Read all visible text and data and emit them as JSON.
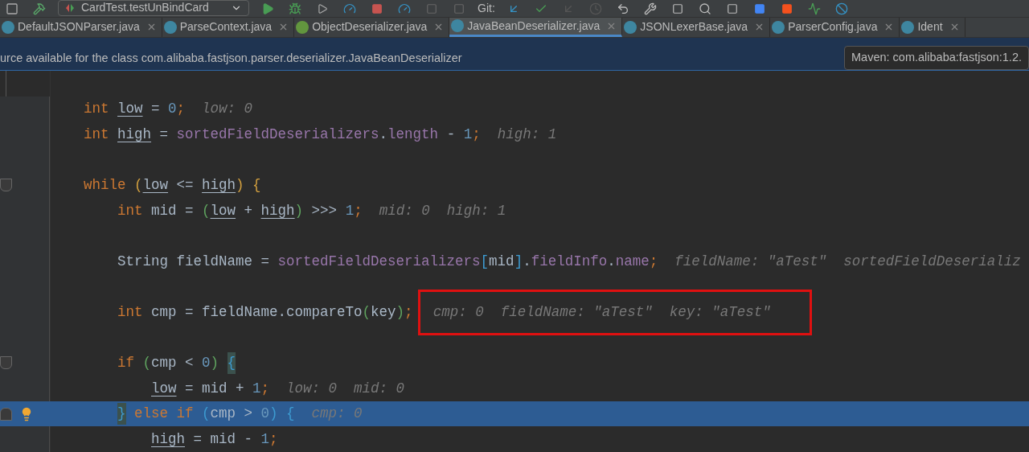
{
  "toolbar": {
    "run_config": "CardTest.testUnBindCard",
    "git_label": "Git:"
  },
  "tabs": [
    {
      "label": "DefaultJSONParser.java",
      "kind": "class",
      "selected": false
    },
    {
      "label": "ParseContext.java",
      "kind": "class",
      "selected": false
    },
    {
      "label": "ObjectDeserializer.java",
      "kind": "interface",
      "selected": false
    },
    {
      "label": "JavaBeanDeserializer.java",
      "kind": "class",
      "selected": true
    },
    {
      "label": "JSONLexerBase.java",
      "kind": "class",
      "selected": false
    },
    {
      "label": "ParserConfig.java",
      "kind": "class",
      "selected": false
    },
    {
      "label": "Ident",
      "kind": "class",
      "selected": false
    }
  ],
  "banner": {
    "message": "urce available for the class com.alibaba.fastjson.parser.deserializer.JavaBeanDeserializer",
    "library": "Maven: com.alibaba:fastjson:1.2."
  },
  "code_lines": [
    {
      "current": false,
      "boxed": false,
      "tokens": [
        {
          "text": "int ",
          "kind": "keyword"
        },
        {
          "text": "low",
          "kind": "local"
        },
        {
          "text": " = ",
          "kind": "plain"
        },
        {
          "text": "0",
          "kind": "number"
        },
        {
          "text": ";",
          "kind": "keyword"
        },
        {
          "text": "low: 0",
          "kind": "hint"
        }
      ]
    },
    {
      "current": false,
      "boxed": false,
      "tokens": [
        {
          "text": "int ",
          "kind": "keyword"
        },
        {
          "text": "high",
          "kind": "local"
        },
        {
          "text": " = ",
          "kind": "plain"
        },
        {
          "text": "sortedFieldDeserializers",
          "kind": "field"
        },
        {
          "text": ".",
          "kind": "plain"
        },
        {
          "text": "length",
          "kind": "field"
        },
        {
          "text": " - ",
          "kind": "plain"
        },
        {
          "text": "1",
          "kind": "number"
        },
        {
          "text": ";",
          "kind": "keyword"
        },
        {
          "text": "high: 1",
          "kind": "hint"
        }
      ]
    },
    {
      "current": false,
      "boxed": false
    },
    {
      "current": false,
      "boxed": false,
      "tokens": [
        {
          "text": "while ",
          "kind": "keyword"
        },
        {
          "text": "(",
          "kind": "paren"
        },
        {
          "text": "low",
          "kind": "local"
        },
        {
          "text": " <= ",
          "kind": "plain"
        },
        {
          "text": "high",
          "kind": "local"
        },
        {
          "text": ")",
          "kind": "paren"
        },
        {
          "text": " {",
          "kind": "paren"
        }
      ],
      "children": [
        {
          "current": false,
          "boxed": false,
          "tokens": [
            {
              "text": "int ",
              "kind": "keyword"
            },
            {
              "text": "mid = ",
              "kind": "plain"
            },
            {
              "text": "(",
              "kind": "paren-inner"
            },
            {
              "text": "low",
              "kind": "local"
            },
            {
              "text": " + ",
              "kind": "plain"
            },
            {
              "text": "high",
              "kind": "local"
            },
            {
              "text": ")",
              "kind": "paren-inner"
            },
            {
              "text": " >>> ",
              "kind": "plain"
            },
            {
              "text": "1",
              "kind": "number"
            },
            {
              "text": ";",
              "kind": "keyword"
            },
            {
              "text": "mid: 0  high: 1",
              "kind": "hint"
            }
          ]
        },
        {
          "current": false,
          "boxed": false
        },
        {
          "current": false,
          "boxed": false,
          "tokens": [
            {
              "text": "String fieldName = ",
              "kind": "plain"
            },
            {
              "text": "sortedFieldDeserializers",
              "kind": "field"
            },
            {
              "text": "[",
              "kind": "bracket"
            },
            {
              "text": "mid",
              "kind": "plain"
            },
            {
              "text": "]",
              "kind": "bracket"
            },
            {
              "text": ".",
              "kind": "plain"
            },
            {
              "text": "fieldInfo",
              "kind": "field"
            },
            {
              "text": ".",
              "kind": "plain"
            },
            {
              "text": "name",
              "kind": "field"
            },
            {
              "text": ";",
              "kind": "keyword"
            },
            {
              "text": "fieldName: \"aTest\"  sortedFieldDeserializ",
              "kind": "hint"
            }
          ]
        },
        {
          "current": false,
          "boxed": false
        },
        {
          "current": false,
          "boxed": true,
          "tokens": [
            {
              "text": "int ",
              "kind": "keyword"
            },
            {
              "text": "cmp = fieldName.compareTo",
              "kind": "plain"
            },
            {
              "text": "(",
              "kind": "paren-inner"
            },
            {
              "text": "key",
              "kind": "plain"
            },
            {
              "text": ")",
              "kind": "paren-inner"
            },
            {
              "text": ";",
              "kind": "keyword"
            },
            {
              "text": "cmp: 0  fieldName: \"aTest\"  key: \"aTest\"",
              "kind": "hint"
            }
          ]
        },
        {
          "current": false,
          "boxed": false
        },
        {
          "current": false,
          "boxed": false,
          "tokens": [
            {
              "text": "if ",
              "kind": "keyword"
            },
            {
              "text": "(",
              "kind": "paren-inner"
            },
            {
              "text": "cmp < ",
              "kind": "plain"
            },
            {
              "text": "0",
              "kind": "number"
            },
            {
              "text": ") ",
              "kind": "paren-inner"
            },
            {
              "text": "{",
              "kind": "matched-brace"
            }
          ],
          "children": [
            {
              "current": false,
              "boxed": false,
              "tokens": [
                {
                  "text": "low",
                  "kind": "local"
                },
                {
                  "text": " = mid + ",
                  "kind": "plain"
                },
                {
                  "text": "1",
                  "kind": "number"
                },
                {
                  "text": ";",
                  "kind": "keyword"
                },
                {
                  "text": "low: 0  mid: 0",
                  "kind": "hint"
                }
              ]
            }
          ]
        },
        {
          "current": true,
          "boxed": false,
          "intention": true,
          "tokens": [
            {
              "text": "}",
              "kind": "matched-brace"
            },
            {
              "text": " else if ",
              "kind": "keyword"
            },
            {
              "text": "(",
              "kind": "brace-blue"
            },
            {
              "text": "cmp > ",
              "kind": "plain"
            },
            {
              "text": "0",
              "kind": "number"
            },
            {
              "text": ")",
              "kind": "brace-blue"
            },
            {
              "text": " {",
              "kind": "brace-blue"
            },
            {
              "text": "cmp: 0",
              "kind": "hint"
            }
          ],
          "children": [
            {
              "current": false,
              "boxed": false,
              "tokens": [
                {
                  "text": "high",
                  "kind": "local"
                },
                {
                  "text": " = mid - ",
                  "kind": "plain"
                },
                {
                  "text": "1",
                  "kind": "number"
                },
                {
                  "text": ";",
                  "kind": "keyword"
                }
              ]
            }
          ]
        }
      ]
    }
  ]
}
